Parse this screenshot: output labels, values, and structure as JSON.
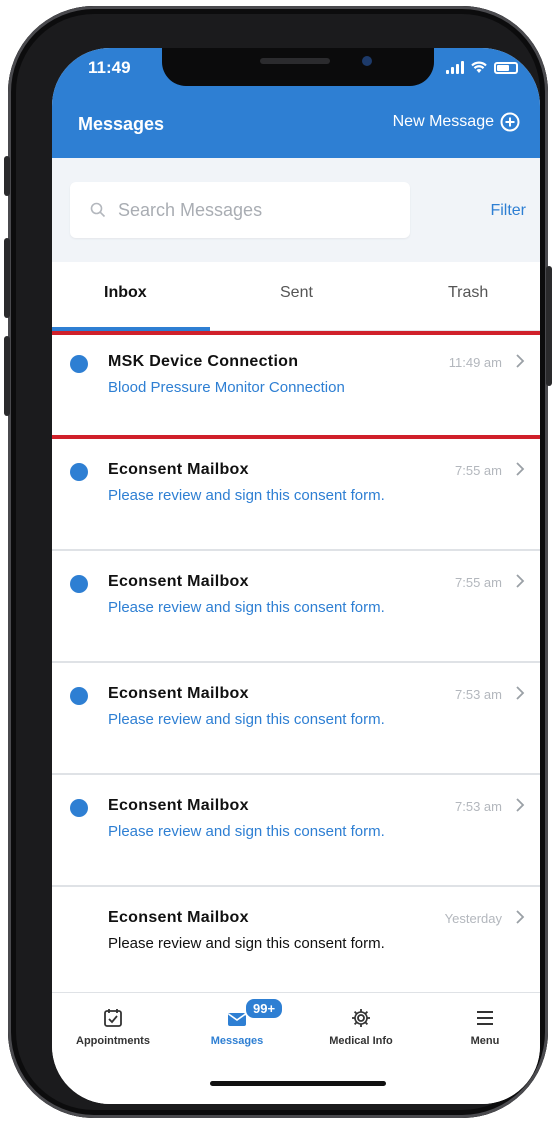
{
  "status_bar": {
    "time": "11:49"
  },
  "header": {
    "title": "Messages",
    "new_message_label": "New Message"
  },
  "search": {
    "placeholder": "Search Messages",
    "value": "",
    "filter_label": "Filter"
  },
  "tabs": [
    {
      "label": "Inbox",
      "active": true
    },
    {
      "label": "Sent",
      "active": false
    },
    {
      "label": "Trash",
      "active": false
    }
  ],
  "messages": [
    {
      "sender": "MSK Device Connection",
      "preview": "Blood Pressure Monitor Connection",
      "time": "11:49 am",
      "unread": true,
      "highlighted": true
    },
    {
      "sender": "Econsent Mailbox",
      "preview": "Please review and sign this consent form.",
      "time": "7:55 am",
      "unread": true,
      "highlighted": false
    },
    {
      "sender": "Econsent Mailbox",
      "preview": "Please review and sign this consent form.",
      "time": "7:55 am",
      "unread": true,
      "highlighted": false
    },
    {
      "sender": "Econsent Mailbox",
      "preview": "Please review and sign this consent form.",
      "time": "7:53 am",
      "unread": true,
      "highlighted": false
    },
    {
      "sender": "Econsent Mailbox",
      "preview": "Please review and sign this consent form.",
      "time": "7:53 am",
      "unread": true,
      "highlighted": false
    },
    {
      "sender": "Econsent Mailbox",
      "preview": "Please review and sign this consent form.",
      "time": "Yesterday",
      "unread": false,
      "highlighted": false
    }
  ],
  "bottom_nav": [
    {
      "label": "Appointments",
      "icon": "calendar-check-icon",
      "active": false
    },
    {
      "label": "Messages",
      "icon": "envelope-icon",
      "active": true,
      "badge": "99+"
    },
    {
      "label": "Medical Info",
      "icon": "gear-icon",
      "active": false
    },
    {
      "label": "Menu",
      "icon": "hamburger-menu-icon",
      "active": false
    }
  ],
  "colors": {
    "brand_blue": "#2e7fd3",
    "highlight_red": "#d0202a"
  }
}
